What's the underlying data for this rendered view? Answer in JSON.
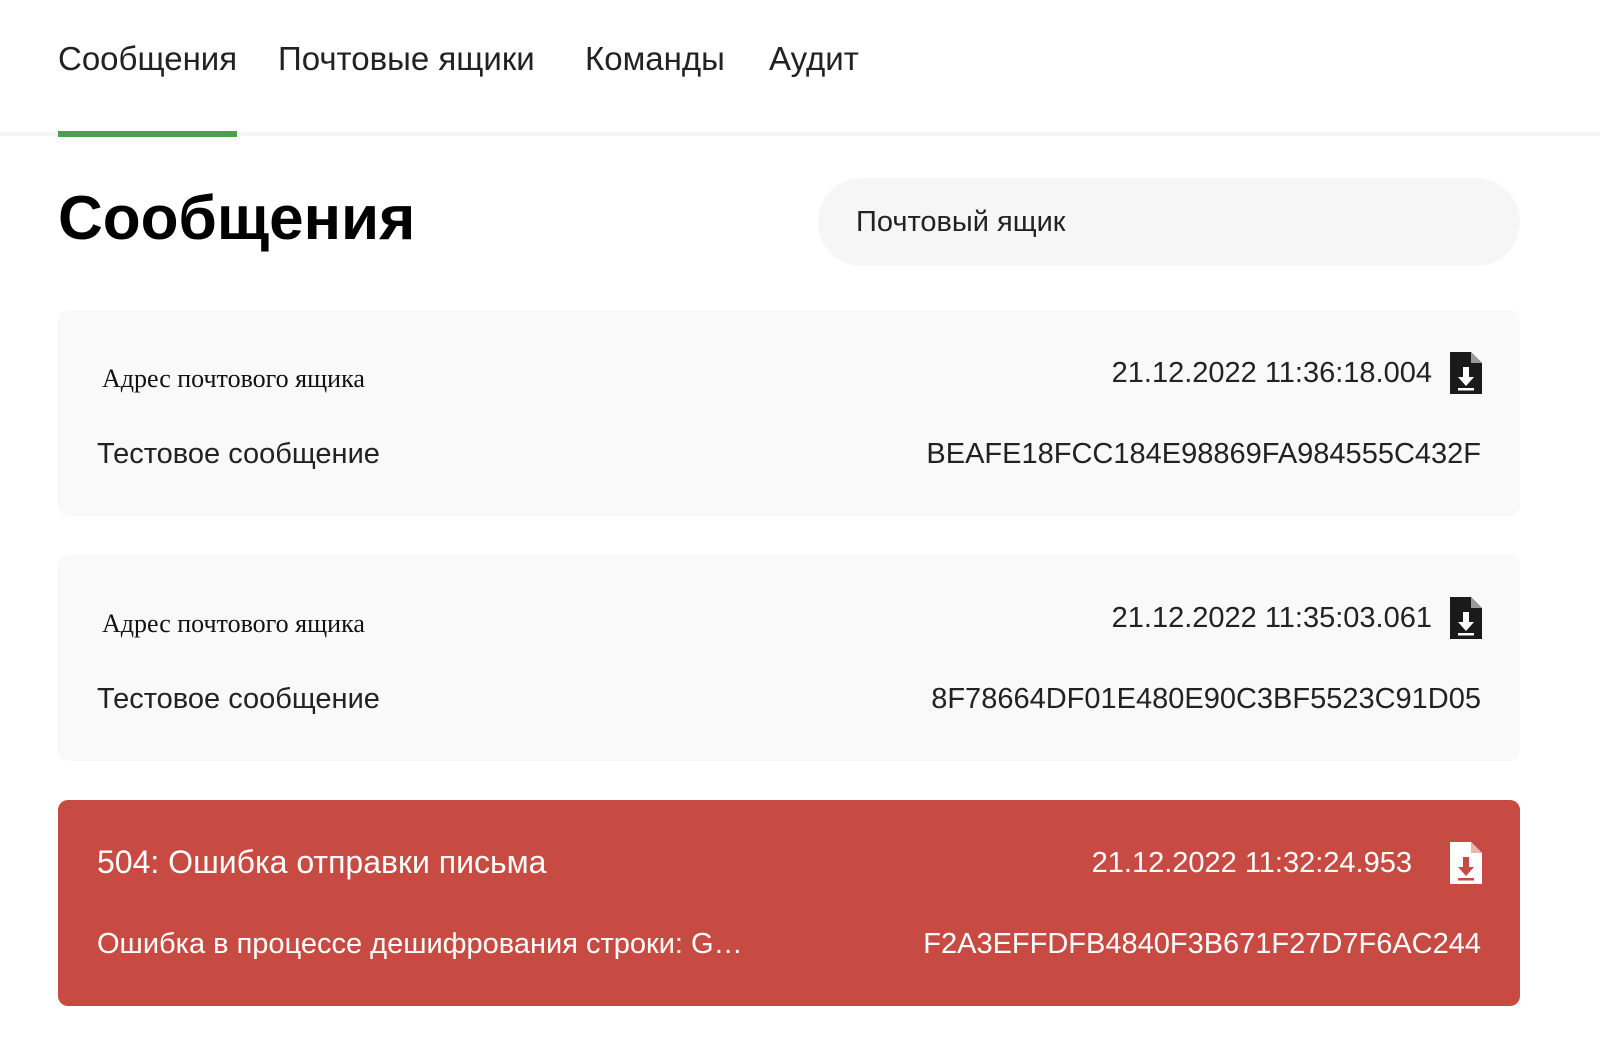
{
  "nav": {
    "tabs": [
      {
        "label": "Сообщения",
        "active": true
      },
      {
        "label": "Почтовые ящики",
        "active": false
      },
      {
        "label": "Команды",
        "active": false
      },
      {
        "label": "Аудит",
        "active": false
      }
    ],
    "accent_color": "#4aa148"
  },
  "page": {
    "title": "Сообщения",
    "mailbox_filter": {
      "label": "Почтовый ящик"
    }
  },
  "messages": [
    {
      "address": "Адрес почтового ящика",
      "timestamp": "21.12.2022 11:36:18.004",
      "subject": "Тестовое сообщение",
      "id": "BEAFE18FCC184E98869FA984555C432F",
      "icon": "file-download-icon"
    },
    {
      "address": "Адрес почтового ящика",
      "timestamp": "21.12.2022 11:35:03.061",
      "subject": "Тестовое сообщение",
      "id": "8F78664DF01E480E90C3BF5523C91D05",
      "icon": "file-download-icon"
    },
    {
      "error_title": "504: Ошибка отправки письма",
      "timestamp": "21.12.2022 11:32:24.953",
      "subject": "Ошибка в процессе дешифрования строки: G…",
      "id": "F2A3EFFDFB4840F3B671F27D7F6AC244",
      "icon": "file-download-icon",
      "status_color": "#c84b43"
    }
  ]
}
